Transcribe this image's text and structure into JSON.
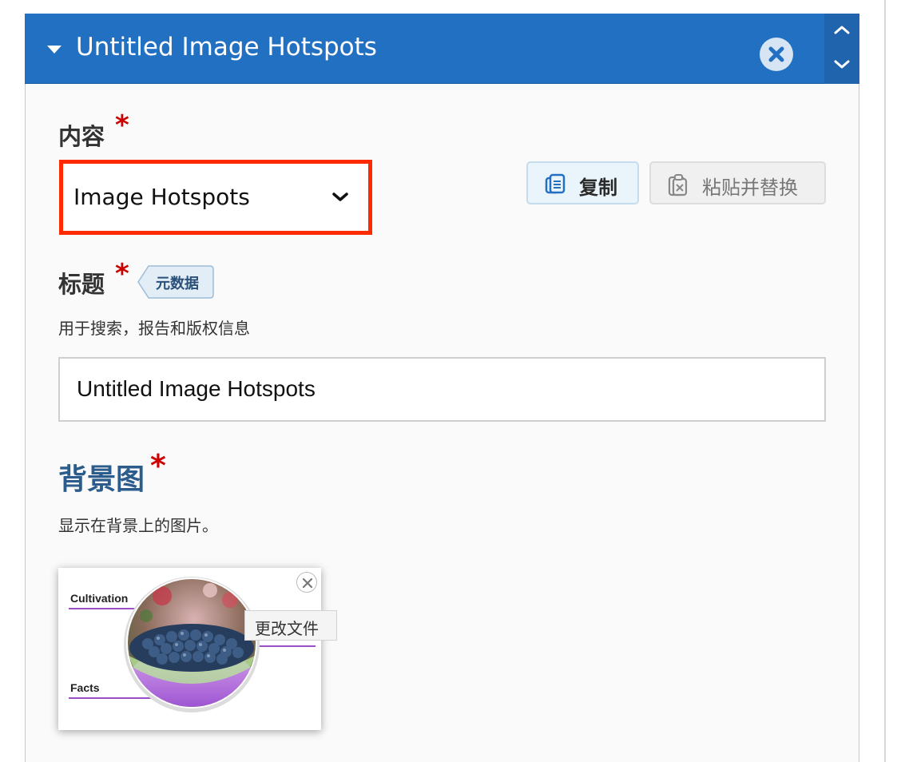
{
  "header": {
    "title": "Untitled Image Hotspots",
    "remove_icon": "close-circle-icon",
    "move_up_icon": "chevron-up-icon",
    "move_down_icon": "chevron-down-icon",
    "collapse_icon": "caret-down-icon",
    "background_color": "#2270c2"
  },
  "content_field": {
    "label": "内容",
    "required_mark": "*",
    "selected_value": "Image Hotspots",
    "highlight_color": "#ff2a00"
  },
  "actions": {
    "copy_label": "复制",
    "paste_replace_label": "粘贴并替换"
  },
  "title_field": {
    "label": "标题",
    "required_mark": "*",
    "metadata_tag": "元数据",
    "description": "用于搜索，报告和版权信息",
    "value": "Untitled Image Hotspots"
  },
  "background_field": {
    "label": "背景图",
    "required_mark": "*",
    "description": "显示在背景上的图片。",
    "thumbnail_texts": [
      "Cultivation",
      "Facts"
    ],
    "change_file_label": "更改文件"
  }
}
